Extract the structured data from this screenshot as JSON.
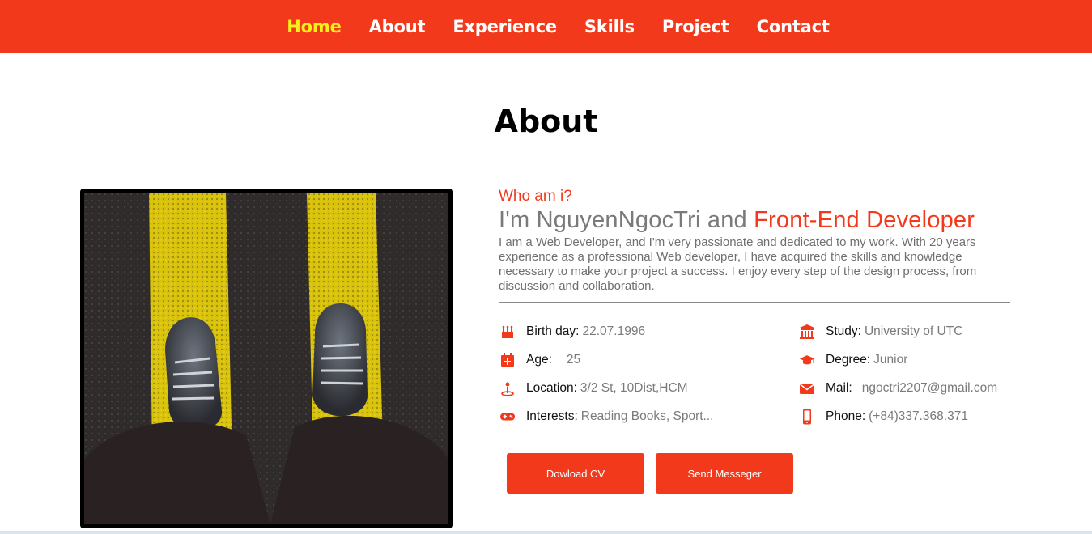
{
  "nav": {
    "items": [
      {
        "label": "Home",
        "active": true
      },
      {
        "label": "About",
        "active": false
      },
      {
        "label": "Experience",
        "active": false
      },
      {
        "label": "Skills",
        "active": false
      },
      {
        "label": "Project",
        "active": false
      },
      {
        "label": "Contact",
        "active": false
      }
    ]
  },
  "about": {
    "title": "About",
    "who_am_i": "Who am i?",
    "headline_name": "I'm NguyenNgocTri and ",
    "headline_role": "Front-End Developer",
    "bio": "I am a Web Developer, and I'm very passionate and dedicated to my work. With 20 years experience as a professional Web developer, I have acquired the skills and knowledge necessary to make your project a success. I enjoy every step of the design process, from discussion and collaboration.",
    "details_left": [
      {
        "icon": "birthday-cake-icon",
        "label": "Birth day:",
        "value": "22.07.1996"
      },
      {
        "icon": "calendar-plus-icon",
        "label": "Age:",
        "value": "25"
      },
      {
        "icon": "location-pin-icon",
        "label": "Location:",
        "value": "3/2 St, 10Dist,HCM"
      },
      {
        "icon": "gamepad-icon",
        "label": "Interests:",
        "value": "Reading Books, Sport..."
      }
    ],
    "details_right": [
      {
        "icon": "university-icon",
        "label": "Study:",
        "value": "University of UTC"
      },
      {
        "icon": "graduation-cap-icon",
        "label": "Degree:",
        "value": "Junior"
      },
      {
        "icon": "envelope-icon",
        "label": "Mail:",
        "value": "ngoctri2207@gmail.com"
      },
      {
        "icon": "mobile-phone-icon",
        "label": "Phone:",
        "value": "(+84)337.368.371"
      }
    ],
    "buttons": {
      "download_cv": "Dowload CV",
      "send_message": "Send Messeger"
    }
  },
  "colors": {
    "accent": "#f2391b",
    "nav_active": "#f5f01a",
    "text_muted": "#7a7a7a"
  }
}
